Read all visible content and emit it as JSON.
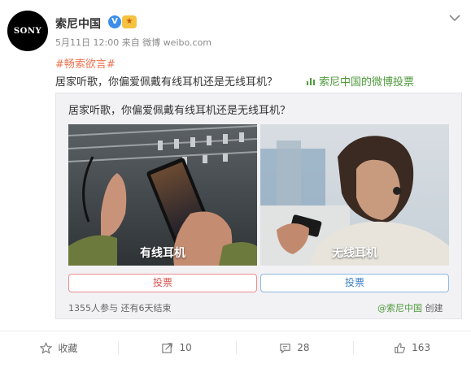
{
  "post": {
    "avatar_text": "SONY",
    "user_name": "索尼中国",
    "verified_mark": "V",
    "meta": "5月11日 12:00 来自 微博 weibo.com",
    "hashtag": "#畅索欲言#",
    "content": "居家听歌，你偏爱佩戴有线耳机还是无线耳机？",
    "vote_link_label": "索尼中国的微博投票"
  },
  "vote": {
    "question": "居家听歌，你偏爱佩戴有线耳机还是无线耳机？",
    "options": [
      {
        "caption": "有线耳机",
        "button_label": "投票"
      },
      {
        "caption": "无线耳机",
        "button_label": "投票"
      }
    ],
    "stats": "1355人参与 还有6天结束",
    "source_user": "@索尼中国",
    "source_suffix": " 创建"
  },
  "actions": {
    "favorite_label": "收藏",
    "repost_count": "10",
    "comment_count": "28",
    "like_count": "163"
  },
  "colors": {
    "hashtag": "#eb7350",
    "vote_link": "#4e9a3a",
    "vote_red": "#d9534f",
    "vote_blue": "#3b7fc4"
  }
}
